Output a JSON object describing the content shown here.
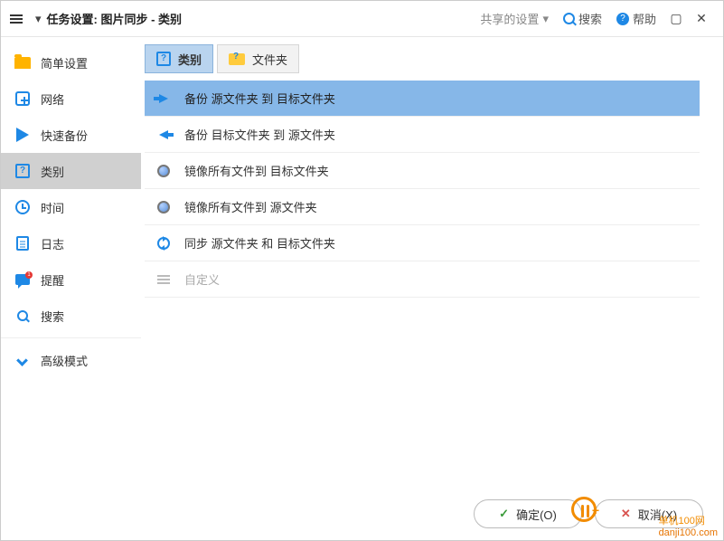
{
  "titlebar": {
    "title": "任务设置: 图片同步 - 类别",
    "shared_settings": "共享的设置",
    "search": "搜索",
    "help": "帮助"
  },
  "sidebar": {
    "items": [
      {
        "label": "简单设置"
      },
      {
        "label": "网络"
      },
      {
        "label": "快速备份"
      },
      {
        "label": "类别"
      },
      {
        "label": "时间"
      },
      {
        "label": "日志"
      },
      {
        "label": "提醒"
      },
      {
        "label": "搜索"
      },
      {
        "label": "高级模式"
      }
    ]
  },
  "tabs": {
    "category": "类别",
    "folder": "文件夹"
  },
  "options": [
    {
      "label": "备份 源文件夹 到 目标文件夹"
    },
    {
      "label": "备份 目标文件夹 到 源文件夹"
    },
    {
      "label": "镜像所有文件到 目标文件夹"
    },
    {
      "label": "镜像所有文件到 源文件夹"
    },
    {
      "label": "同步 源文件夹 和 目标文件夹"
    },
    {
      "label": "自定义"
    }
  ],
  "footer": {
    "ok": "确定(O)",
    "cancel": "取消(X)"
  },
  "watermark": {
    "text": "单机100网",
    "url": "danji100.com"
  }
}
